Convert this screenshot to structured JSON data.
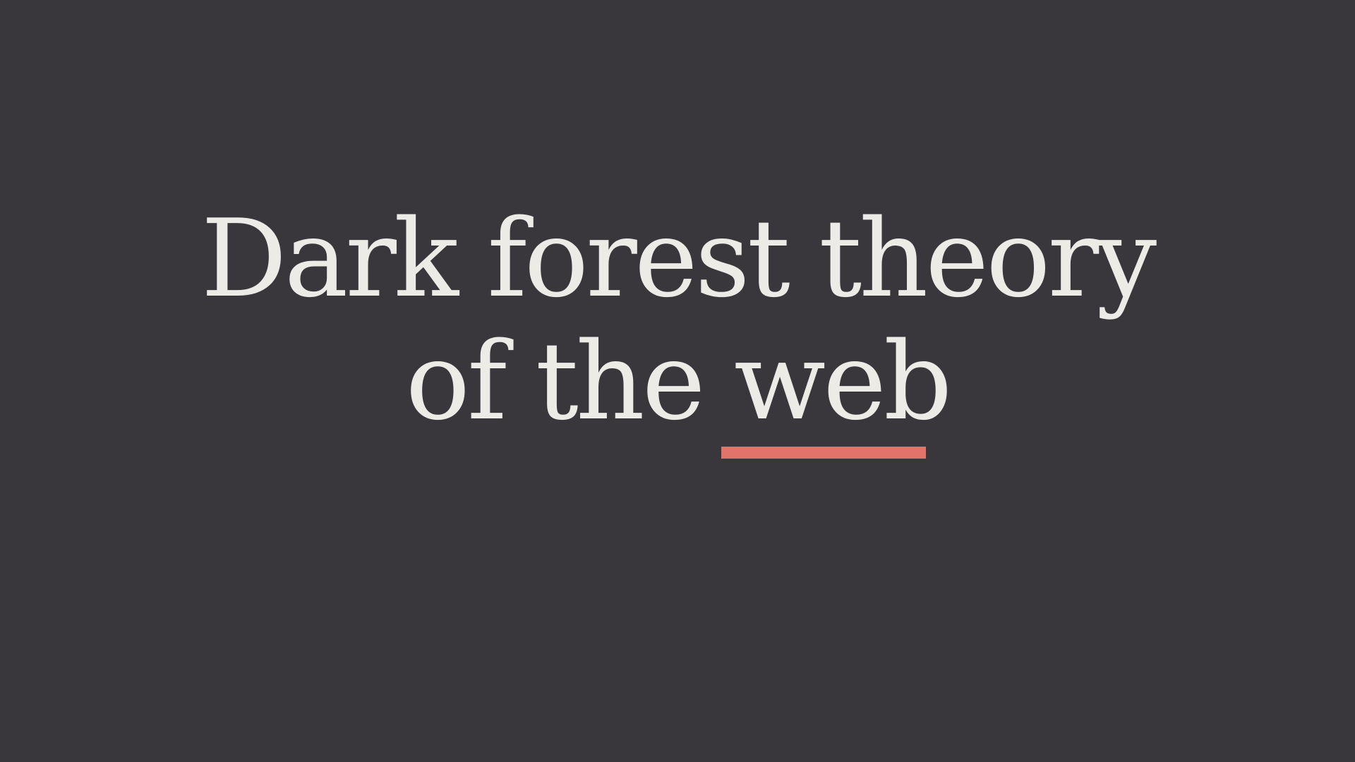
{
  "title": {
    "line1": "Dark forest theory",
    "line2": "of the web"
  },
  "colors": {
    "background": "#39373c",
    "text": "#ecebe6",
    "accent_underline": "#e0736a"
  }
}
